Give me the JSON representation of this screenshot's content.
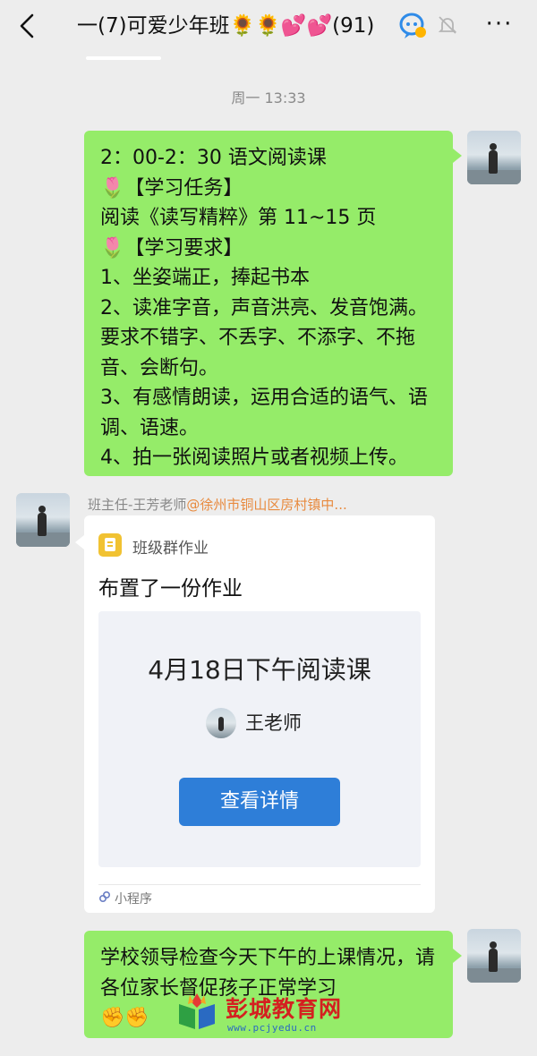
{
  "header": {
    "back_icon": "back-chevron-icon",
    "title": "一(7)可爱少年班🌻🌻💕💕(91)",
    "voice_icon": "voice-chat-icon",
    "mute_icon": "bell-mute-icon",
    "more_label": "···"
  },
  "chat": {
    "timestamp": "周一 13:33",
    "message1": {
      "lines": [
        "2：00-2：30  语文阅读课",
        "🌷【学习任务】",
        "阅读《读写精粹》第 11~15 页",
        "🌷【学习要求】",
        "1、坐姿端正，捧起书本",
        "2、读准字音，声音洪亮、发音饱满。要求不错字、不丢字、不添字、不拖音、会断句。",
        "3、有感情朗读，运用合适的语气、语调、语速。",
        "4、拍一张阅读照片或者视频上传。"
      ]
    },
    "message2": {
      "sender_name": "班主任-王芳老师",
      "sender_org": "@徐州市铜山区房村镇中...",
      "card": {
        "app_name": "班级群作业",
        "description": "布置了一份作业",
        "title": "4月18日下午阅读课",
        "teacher": "王老师",
        "button_label": "查看详情",
        "footer_label": "小程序"
      }
    },
    "message3": {
      "text": "学校领导检查今天下午的上课情况，请各位家长督促孩子正常学习",
      "emoji": "✊✊"
    }
  },
  "watermark": {
    "name": "彭城教育网",
    "url": "www.pcjyedu.cn"
  },
  "colors": {
    "green_bubble": "#95ec69",
    "background": "#ededed",
    "button_blue": "#2e7ed8",
    "org_orange": "#e88a3e",
    "watermark_red": "#d42020"
  }
}
